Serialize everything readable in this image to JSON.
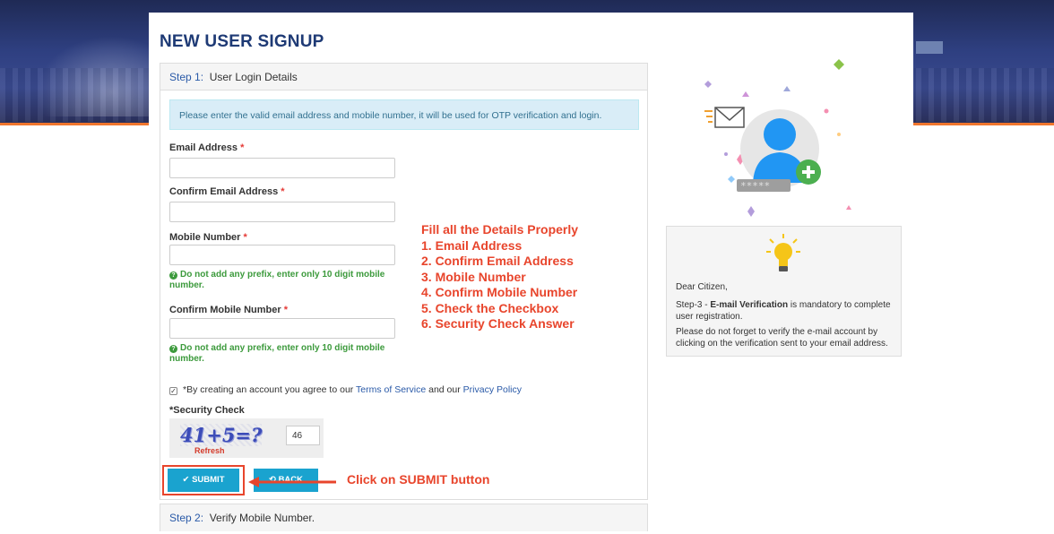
{
  "page_title": "NEW USER SIGNUP",
  "step1": {
    "number": "Step 1:",
    "title": "User Login Details"
  },
  "step2": {
    "number": "Step 2:",
    "title": "Verify Mobile Number."
  },
  "info_message": "Please enter the valid email address and mobile number, it will be used for OTP verification and login.",
  "fields": {
    "email_label": "Email Address",
    "confirm_email_label": "Confirm Email Address",
    "mobile_label": "Mobile Number",
    "confirm_mobile_label": "Confirm Mobile Number",
    "required_mark": "*"
  },
  "hints": {
    "mobile_hint": "Do not add any prefix, enter only 10 digit mobile number.",
    "confirm_mobile_hint": "Do not add any prefix, enter only 10 digit mobile number."
  },
  "agree": {
    "checked": true,
    "prefix": "*By creating an account you agree to our ",
    "terms_link": "Terms of Service",
    "middle": " and our ",
    "privacy_link": "Privacy Policy"
  },
  "security": {
    "label": "*Security Check",
    "captcha_text": "41+5=?",
    "refresh_label": "Refresh",
    "answer": "46"
  },
  "buttons": {
    "submit": "✔ SUBMIT",
    "back": "⟲ BACK"
  },
  "annotations": {
    "instructions": [
      "Fill all the Details Properly",
      "1. Email Address",
      "2. Confirm Email Address",
      "3. Mobile Number",
      "4. Confirm Mobile Number",
      "5. Check the Checkbox",
      "6. Security Check Answer"
    ],
    "click_note": "Click on SUBMIT button",
    "color": "#e8452c"
  },
  "citizen_note": {
    "greeting": "Dear Citizen,",
    "line1_prefix": "Step-3 - ",
    "line1_bold": "E-mail Verification",
    "line1_suffix": " is mandatory to complete user registration.",
    "line2": "Please do not forget to verify the e-mail account by clicking on the verification sent to your email address."
  },
  "illustration": {
    "password_mask": "*****"
  },
  "colors": {
    "accent": "#1aa3cf",
    "title": "#1e3a75",
    "hint_green": "#3c9a3c",
    "info_bg": "#d9edf7",
    "banner_stripe": "#f0762e"
  }
}
